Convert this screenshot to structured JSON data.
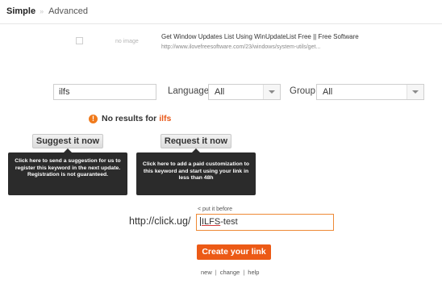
{
  "tabs": {
    "active": "Simple",
    "separator": "»",
    "other": "Advanced"
  },
  "result": {
    "thumb_text": "no image",
    "title": "Get Window Updates List Using WinUpdateList Free || Free Software",
    "url": "http://www.ilovefreesoftware.com/23/windows/system-utils/get..."
  },
  "search": {
    "keyword": "ilfs",
    "language_label": "Language:",
    "language_value": "All",
    "group_label": "Group:",
    "group_value": "All"
  },
  "no_results": {
    "icon": "!",
    "text": "No results for",
    "keyword": "ilfs"
  },
  "suggest": {
    "button": "Suggest it now",
    "tooltip": "Click here to send a suggestion for us to register this keyword in the next update. Registration is not guaranteed."
  },
  "request": {
    "button": "Request it now",
    "tooltip": "Click here to add a paid customization to this keyword and start using your link in less than 48h"
  },
  "link": {
    "put_before": "< put it before",
    "prefix": "http://click.ug/",
    "value_underlined": "ILFS",
    "value_rest": "-test",
    "create_button": "Create your link"
  },
  "footer": {
    "new": "new",
    "change": "change",
    "help": "help",
    "sep": "|"
  },
  "colors": {
    "accent": "#ec5a16",
    "tooltip_bg": "#2b2b2b",
    "warning": "#f07a1c"
  },
  "icons": {
    "warning": "warning-circle-icon",
    "dropdown": "chevron-down-icon"
  }
}
